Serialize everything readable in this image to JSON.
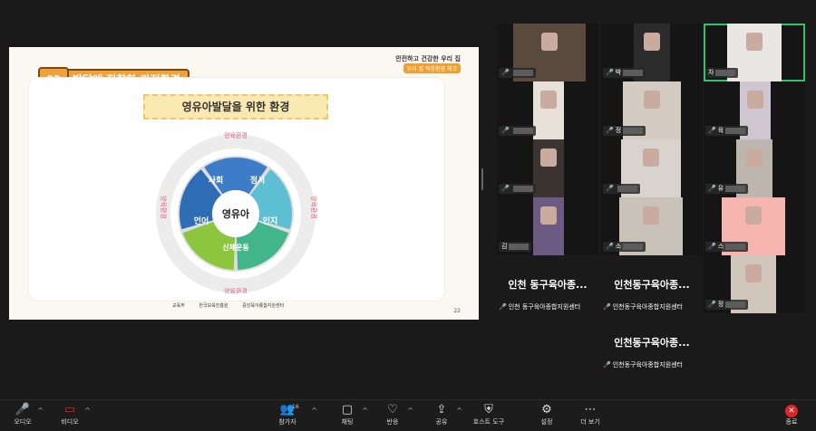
{
  "slide": {
    "header_line1": "안전하고 건강한 우리 집",
    "header_line2": "우리 집 적응환경 체크",
    "badge": "03",
    "title": "발달에 적합한 가정환경",
    "subtitle": "영유아발달을 위한 환경",
    "center_label": "영유아",
    "segments": [
      "사회",
      "정서",
      "인지",
      "신체운동",
      "언어"
    ],
    "env_label": "양육환경",
    "footer_logos": [
      "교육부",
      "한국보육진흥원",
      "중앙육아종합지원센터"
    ],
    "page_number": "22",
    "colors": {
      "social": "#3c7cc9",
      "emotion": "#5cbfd3",
      "cognition": "#43b58a",
      "physical": "#8cc63f",
      "language": "#2e6db6"
    }
  },
  "participants": [
    {
      "name": "",
      "muted": true
    },
    {
      "name": "박",
      "muted": true
    },
    {
      "name": "차",
      "muted": false,
      "active": true
    },
    {
      "name": "",
      "muted": true
    },
    {
      "name": "정",
      "muted": true
    },
    {
      "name": "육",
      "muted": true
    },
    {
      "name": "",
      "muted": true
    },
    {
      "name": "",
      "muted": true
    },
    {
      "name": "유",
      "muted": true
    },
    {
      "name": "김",
      "muted": false
    },
    {
      "name": "소",
      "muted": true
    },
    {
      "name": "스",
      "muted": true
    },
    {
      "name": "정",
      "muted": true
    }
  ],
  "name_tiles": [
    {
      "display": "인천 동구육아종...",
      "full": "인천 동구육아종합지원센터"
    },
    {
      "display": "인천동구육아종...",
      "full": "인천동구육아종합지원센터"
    },
    {
      "display": "인천동구육아종...",
      "full": "인천동구육아종합지원센터"
    }
  ],
  "toolbar": {
    "audio": "오디오",
    "video": "비디오",
    "participants": "참가자",
    "participant_count": "16",
    "chat": "채팅",
    "reactions": "반응",
    "share": "공유",
    "host_tools": "호스트 도구",
    "settings": "설정",
    "more": "더 보기",
    "end": "종료"
  }
}
